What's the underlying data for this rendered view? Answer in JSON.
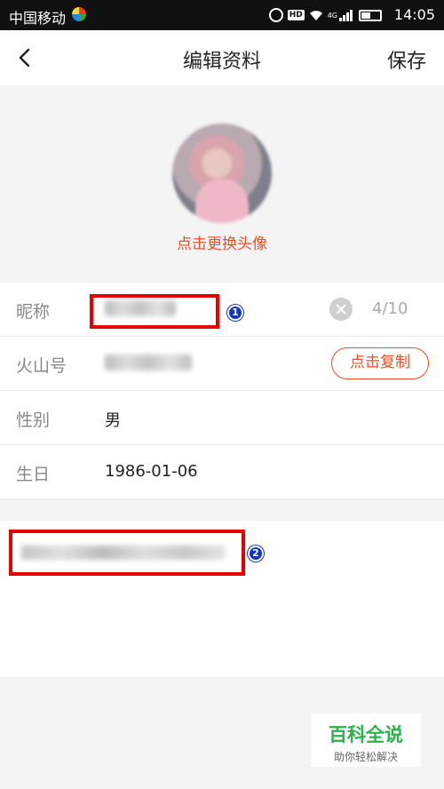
{
  "status_bar": {
    "carrier": "中国移动",
    "network_label": "4G",
    "hd_label": "HD",
    "time": "14:05",
    "icons": [
      "carrier-logo-icon",
      "alarm-icon",
      "hd-icon",
      "wifi-icon",
      "signal-icon",
      "battery-icon"
    ]
  },
  "nav": {
    "title": "编辑资料",
    "save_label": "保存",
    "back_icon": "chevron-left-icon"
  },
  "avatar": {
    "change_label": "点击更换头像"
  },
  "form": {
    "nickname": {
      "label": "昵称",
      "count": "4/10"
    },
    "huoshan_id": {
      "label": "火山号",
      "copy_label": "点击复制"
    },
    "gender": {
      "label": "性别",
      "value": "男"
    },
    "birthday": {
      "label": "生日",
      "value": "1986-01-06"
    }
  },
  "annotations": {
    "badge_1": "1",
    "badge_2": "2",
    "highlight_color": "#e60000"
  },
  "watermark": {
    "title": "百科全说",
    "subtitle": "助你轻松解决"
  },
  "colors": {
    "accent": "#f04e23"
  }
}
